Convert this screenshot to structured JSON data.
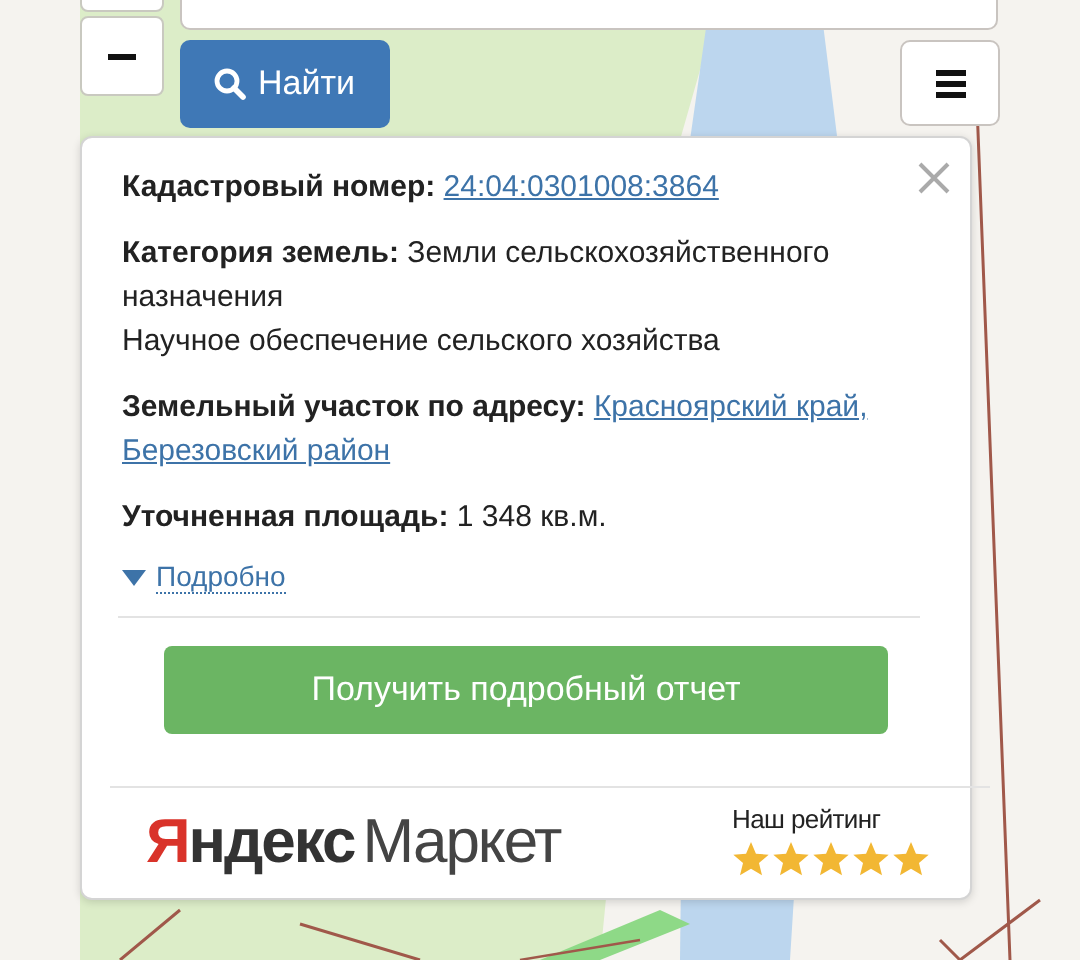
{
  "search": {
    "button": "Найти"
  },
  "popup": {
    "fields": [
      {
        "kind": "link",
        "label": "Кадастровый номер:",
        "links": [
          "24:04:0301008:3864"
        ]
      },
      {
        "kind": "text",
        "text": "**Категория земель:** Земли сельскохозяйственного назначения"
      },
      {
        "kind": "note",
        "text": "Научное обеспечение сельского хозяйства"
      },
      {
        "kind": "link",
        "label": "Земельный участок по адресу:",
        "links": [
          "Красноярский край,",
          "Березовский район"
        ]
      },
      {
        "kind": "text",
        "text": "**Уточненная площадь:** 1 348 кв.м."
      }
    ],
    "details_link": "Подробно",
    "report_button": "Получить подробный отчет",
    "logo": {
      "bold": "Яндекс",
      "light": "Маркет"
    },
    "rating": {
      "label": "Наш рейтинг",
      "stars": 5
    }
  }
}
